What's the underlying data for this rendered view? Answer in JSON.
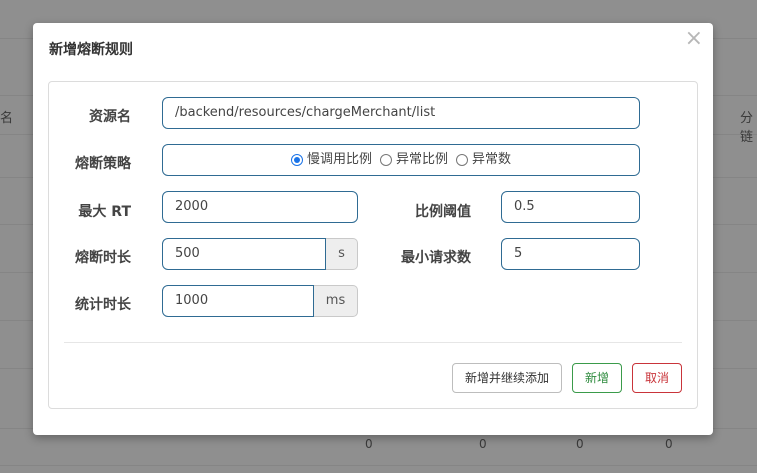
{
  "background": {
    "col_left_header": "名",
    "col_right_header": "分​链",
    "row_values": [
      "0",
      "0",
      "0",
      "0"
    ]
  },
  "modal": {
    "title": "新增熔断规则",
    "close_symbol": "×"
  },
  "form": {
    "resource": {
      "label": "资源名",
      "value": "/backend/resources/chargeMerchant/list"
    },
    "strategy": {
      "label": "熔断策略",
      "options": [
        "慢调用比例",
        "异常比例",
        "异常数"
      ],
      "selected": "慢调用比例"
    },
    "max_rt": {
      "label": "最大 RT",
      "value": "2000"
    },
    "ratio_threshold": {
      "label": "比例阈值",
      "value": "0.5"
    },
    "break_duration": {
      "label": "熔断时长",
      "value": "500",
      "unit": "s"
    },
    "min_requests": {
      "label": "最小请求数",
      "value": "5"
    },
    "stat_duration": {
      "label": "统计时长",
      "value": "1000",
      "unit": "ms"
    }
  },
  "buttons": {
    "add_continue": "新增并继续添加",
    "add": "新增",
    "cancel": "取消"
  },
  "colors": {
    "accent": "#1a73e8",
    "success": "#2e8b3e",
    "danger": "#c9343a",
    "input_border": "#2f6b93"
  }
}
